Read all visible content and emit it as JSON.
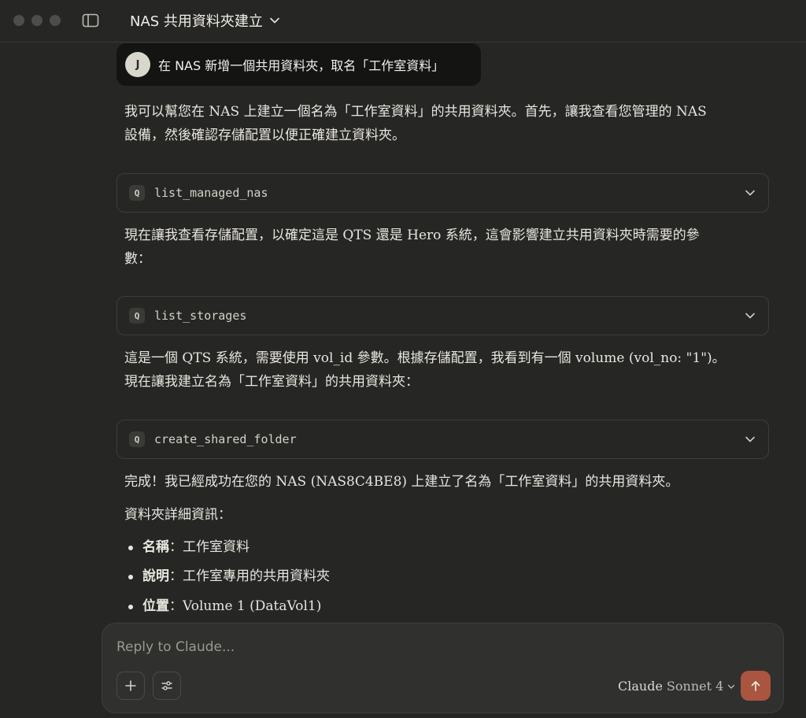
{
  "header": {
    "title": "NAS 共用資料夾建立"
  },
  "user_message": {
    "avatar_initial": "J",
    "text": "在 NAS 新增一個共用資料夾，取名「工作室資料」"
  },
  "assistant": {
    "para1_line1": "我可以幫您在 NAS 上建立一個名為「工作室資料」的共用資料夾。首先，讓我查看您管理的 NAS",
    "para1_line2": "設備，然後確認存儲配置以便正確建立資料夾。",
    "tool1": "list_managed_nas",
    "para2_line1": "現在讓我查看存儲配置，以確定這是 QTS 還是 Hero 系統，這會影響建立共用資料夾時需要的參",
    "para2_line2": "數：",
    "tool2": "list_storages",
    "para3_line1": "這是一個 QTS 系統，需要使用 vol_id 參數。根據存儲配置，我看到有一個 volume (vol_no: \"1\")。",
    "para3_line2": "現在讓我建立名為「工作室資料」的共用資料夾：",
    "tool3": "create_shared_folder",
    "para4": "完成！我已經成功在您的 NAS (NAS8C4BE8) 上建立了名為「工作室資料」的共用資料夾。",
    "para5": "資料夾詳細資訊：",
    "details": [
      {
        "key": "名稱",
        "sep": "：",
        "value": "工作室資料"
      },
      {
        "key": "說明",
        "sep": "：",
        "value": "工作室專用的共用資料夾"
      },
      {
        "key": "位置",
        "sep": "：",
        "value": "Volume 1 (DataVol1)"
      }
    ]
  },
  "tool_badge": "Q",
  "composer": {
    "placeholder": "Reply to Claude...",
    "model_name": "Claude",
    "model_version": "Sonnet 4"
  },
  "colors": {
    "background": "#262624",
    "user_bubble": "#141413",
    "send_button": "#a9553f"
  }
}
